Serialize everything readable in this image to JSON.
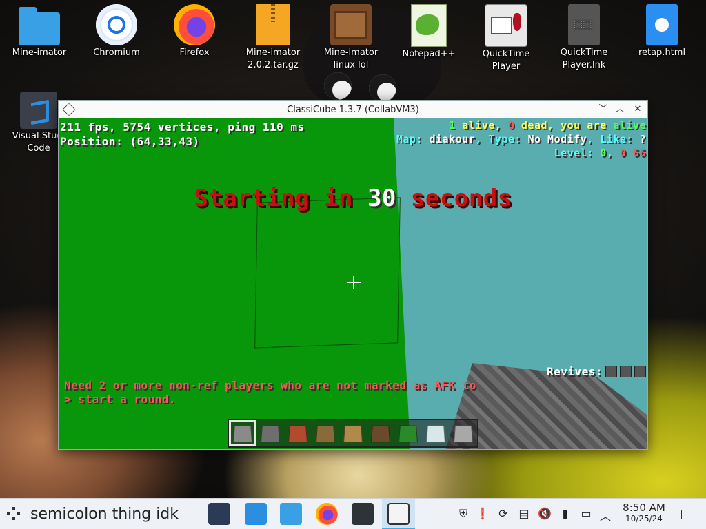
{
  "desktop": {
    "icons": [
      {
        "label": "Mine-imator",
        "icon": "folder-icon"
      },
      {
        "label": "Chromium",
        "icon": "chromium-icon"
      },
      {
        "label": "Firefox",
        "icon": "firefox-icon"
      },
      {
        "label": "Mine-imator 2.0.2.tar.gz",
        "icon": "archive-icon"
      },
      {
        "label": "Mine-imator linux  lol",
        "icon": "mine-imator-icon"
      },
      {
        "label": "Notepad++",
        "icon": "notepad-plus-plus-icon"
      },
      {
        "label": "QuickTime Player",
        "icon": "quicktime-icon"
      },
      {
        "label": "QuickTime Player.lnk",
        "icon": "shortcut-file-icon"
      },
      {
        "label": "retap.html",
        "icon": "html-file-icon"
      },
      {
        "label": "Visual Studio Code",
        "icon": "vscode-icon"
      }
    ],
    "vscode_label_line1": "Visual Studi",
    "vscode_label_line2": "Code"
  },
  "window": {
    "title": "ClassiCube 1.3.7 (CollabVM3)",
    "buttons": [
      "minimize",
      "maximize",
      "close"
    ]
  },
  "game": {
    "fps_line": "211 fps, 5754 vertices, ping 110 ms",
    "position_line": "Position: (64,33,43)",
    "status": {
      "alive_count": "1",
      "alive_text": " alive, ",
      "dead_count": "0",
      "dead_text": " dead, you are ",
      "you_are": "alive",
      "map_label": "Map: ",
      "map_name": "diakour",
      "type_label": ", Type: ",
      "type_value": "No Modify",
      "like_label": ", Like: ",
      "like_value": "?",
      "level_label": "Level: ",
      "level_value": "0",
      "level_sep": ", ",
      "level_extra": "0 66"
    },
    "countdown_prefix": "Starting in ",
    "countdown_number": "30",
    "countdown_suffix": " seconds",
    "chat_line1": "Need 2 or more non-ref players who are not marked as AFK to",
    "chat_line2": "> start a round.",
    "revives_label": "Revives:",
    "revives_slots": 3,
    "hotbar": {
      "selected_index": 0,
      "blocks": [
        {
          "name": "stone",
          "color": "#8a8a8a"
        },
        {
          "name": "cobblestone",
          "color": "#6e6e6e"
        },
        {
          "name": "brick",
          "color": "#b24a2e"
        },
        {
          "name": "wood",
          "color": "#8a6a3a"
        },
        {
          "name": "planks",
          "color": "#b08a4a"
        },
        {
          "name": "log",
          "color": "#6a4a28"
        },
        {
          "name": "leaves",
          "color": "#2a8a2a"
        },
        {
          "name": "glass",
          "color": "#d8e8e8"
        },
        {
          "name": "slab",
          "color": "#a8a8a8"
        }
      ]
    }
  },
  "taskbar": {
    "label": "semicolon thing idk",
    "apps": [
      "settings-icon",
      "store-icon",
      "file-manager-icon",
      "firefox-icon",
      "terminal-icon",
      "classicube-icon"
    ],
    "time": "8:50 AM",
    "date": "10/25/24"
  }
}
